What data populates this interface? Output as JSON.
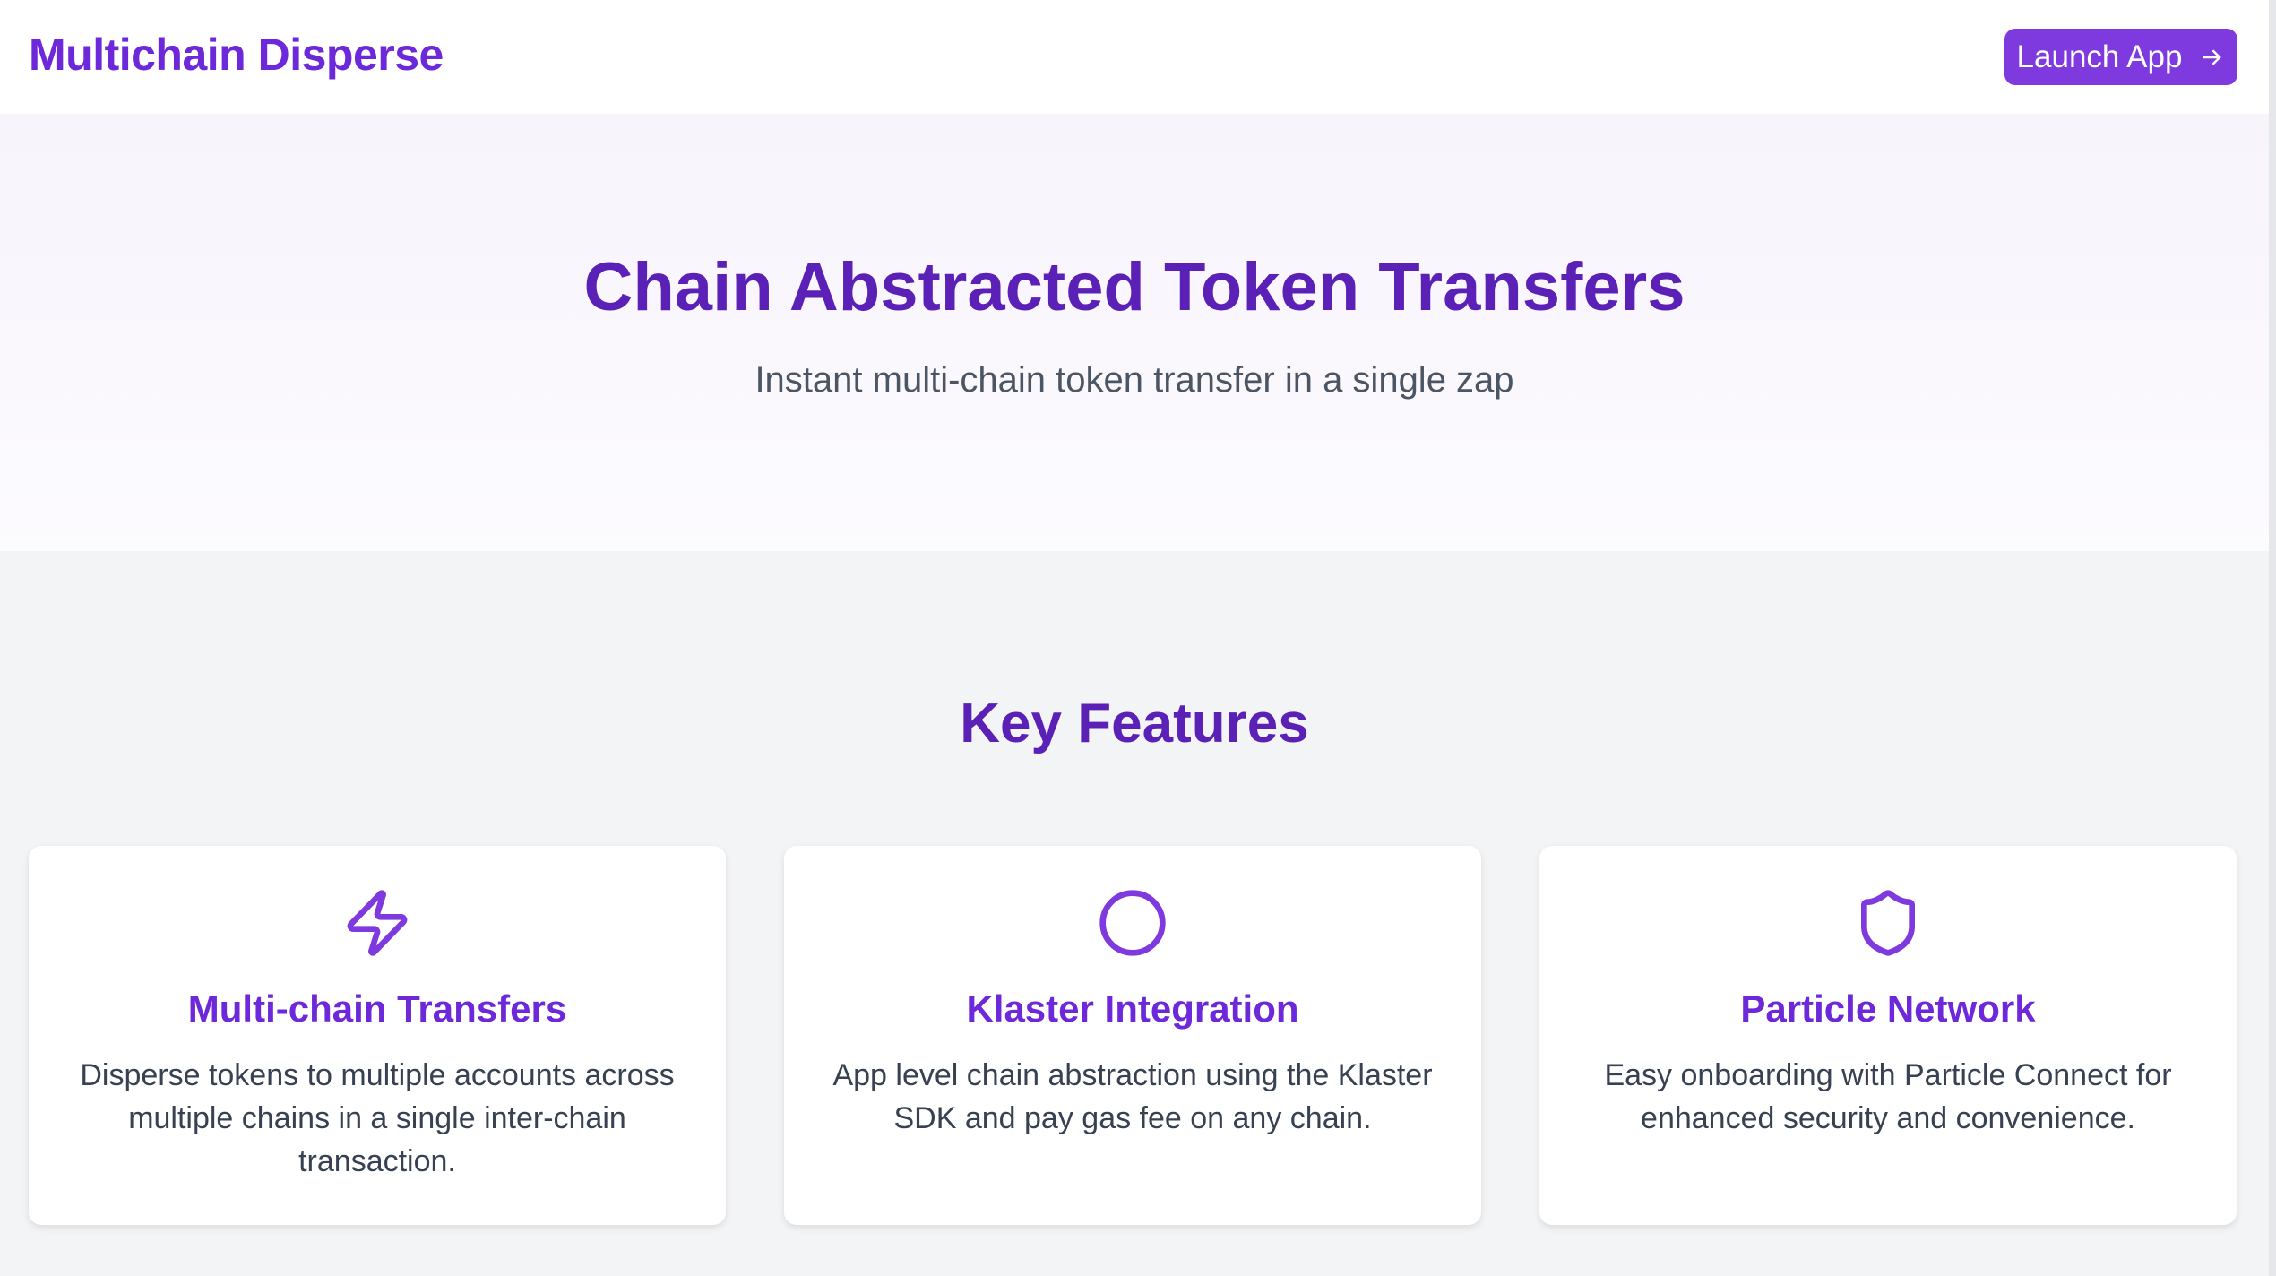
{
  "header": {
    "brand": "Multichain Disperse",
    "launch_label": "Launch App",
    "launch_icon": "arrow-right-icon"
  },
  "hero": {
    "title": "Chain Abstracted Token Transfers",
    "subtitle": "Instant multi-chain token transfer in a single zap"
  },
  "features": {
    "title": "Key Features",
    "items": [
      {
        "icon": "lightning-bolt-icon",
        "title": "Multi-chain Transfers",
        "description": "Disperse tokens to multiple accounts across multiple chains in a single inter-chain transaction."
      },
      {
        "icon": "circle-icon",
        "title": "Klaster Integration",
        "description": "App level chain abstraction using the Klaster SDK and pay gas fee on any chain."
      },
      {
        "icon": "shield-icon",
        "title": "Particle Network",
        "description": "Easy onboarding with Particle Connect for enhanced security and convenience."
      }
    ]
  },
  "colors": {
    "brand_purple": "#6d28d9",
    "heading_purple": "#5b21b6",
    "button_purple": "#7e3adf",
    "body_text": "#374151",
    "page_bg": "#f3f4f6"
  }
}
